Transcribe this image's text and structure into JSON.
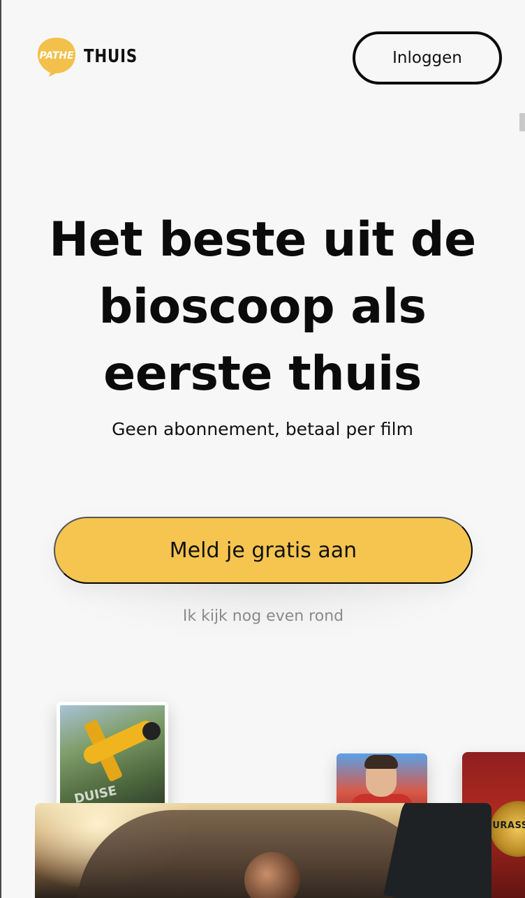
{
  "header": {
    "logo_text": "THUIS",
    "logo_brand": "PATHE",
    "login_label": "Inloggen"
  },
  "hero": {
    "title": "Het beste uit de bioscoop als eerste thuis",
    "subtitle": "Geen abonnement, betaal per film",
    "cta_label": "Meld je gratis aan",
    "browse_label": "Ik kijk nog even rond"
  },
  "posters": {
    "plane_text": "DUISE",
    "jurassic_text": "JURASSIC"
  },
  "colors": {
    "accent": "#f6c550",
    "background": "#f7f7f7",
    "text": "#0b0b0b",
    "muted": "#8a8a8a",
    "logo_yellow": "#f3c04b"
  }
}
